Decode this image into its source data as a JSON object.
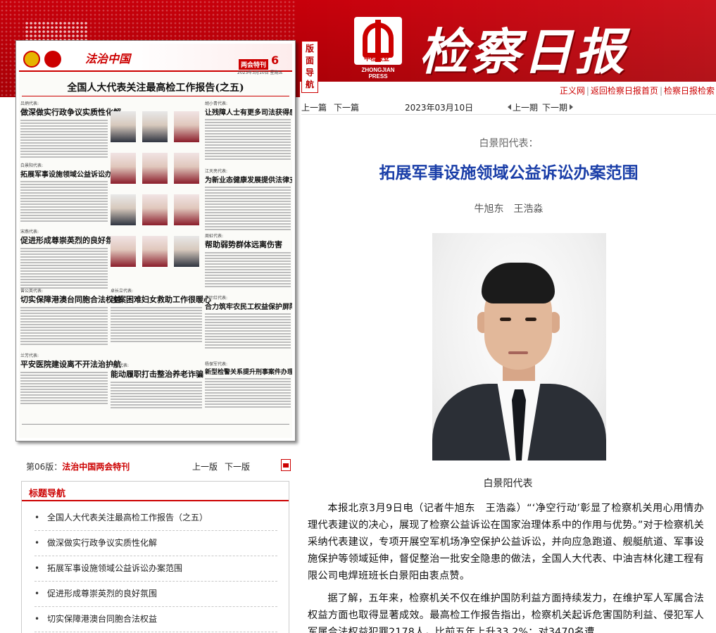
{
  "header": {
    "nav_tag": [
      "版",
      "面",
      "导",
      "航"
    ],
    "logo_label": "中检报业",
    "logo_press": "ZHONGJIAN PRESS",
    "masthead": "检察日报",
    "links": [
      "正义网",
      "返回检察日报首页",
      "检察日报检索"
    ],
    "accent_color": "#c00000"
  },
  "thumbnail": {
    "brand": "法治中国",
    "special_tag": "两会特刊",
    "page_no": "6",
    "date": "2023年3月10日 星期五",
    "big_title": "全国人大代表关注最高检工作报告(之五)",
    "articles": [
      {
        "label": "吕炳代表:",
        "headline": "做深做实行政争议实质性化解"
      },
      {
        "label": "白景阳代表:",
        "headline": "拓展军事设施领域公益诉讼办案范围"
      },
      {
        "label": "宋燕代表:",
        "headline": "促进形成尊崇英烈的良好氛围"
      },
      {
        "label": "曾公英代表:",
        "headline": "切实保障港澳台同胞合法权益"
      },
      {
        "label": "兰芳代表:",
        "headline": "平安医院建设离不开法治护航"
      },
      {
        "label": "胡小青代表:",
        "headline": "让残障人士有更多司法获得感"
      },
      {
        "label": "江天亮代表:",
        "headline": "为新业态健康发展提供法律支持"
      },
      {
        "label": "周虹代表:",
        "headline": "帮助弱势群体远离伤害"
      },
      {
        "label": "李叶红代表:",
        "headline": "合力筑牢农民工权益保护屏障"
      },
      {
        "label": "卓长立代表:",
        "headline": "涉案困难妇女救助工作很暖心"
      },
      {
        "label": "郑锐代表:",
        "headline": "能动履职打击整治养老诈骗"
      },
      {
        "label": "杨保军代表:",
        "headline": "新型检警关系提升刑事案件办理质效"
      }
    ]
  },
  "page_bar": {
    "page_prefix": "第06版：",
    "page_name": "法治中国两会特刊",
    "prev": "上一版",
    "next": "下一版"
  },
  "title_nav": {
    "heading": "标题导航",
    "items": [
      "全国人大代表关注最高检工作报告（之五）",
      "做深做实行政争议实质性化解",
      "拓展军事设施领域公益诉讼办案范围",
      "促进形成尊崇英烈的良好氛围",
      "切实保障港澳台同胞合法权益"
    ]
  },
  "article_nav": {
    "prev_article": "上一篇",
    "next_article": "下一篇",
    "date": "2023年03月10日",
    "prev_issue": "上一期",
    "next_issue": "下一期"
  },
  "article": {
    "subtitle": "白景阳代表：",
    "headline": "拓展军事设施领域公益诉讼办案范围",
    "author": "牛旭东　王浩淼",
    "photo_caption": "白景阳代表",
    "paragraphs": [
      "本报北京3月9日电（记者牛旭东　王浩淼）“‘净空行动’彰显了检察机关用心用情办理代表建议的决心，展现了检察公益诉讼在国家治理体系中的作用与优势。”对于检察机关采纳代表建议，专项开展空军机场净空保护公益诉讼，并向应急跑道、舰艇航道、军事设施保护等领域延伸，督促整治一批安全隐患的做法，全国人大代表、中油吉林化建工程有限公司电焊班班长白景阳由衷点赞。",
      "据了解，五年来，检察机关不仅在维护国防利益方面持续发力，在维护军人军属合法权益方面也取得显著成效。最高检工作报告指出，检察机关起诉危害国防利益、侵犯军人军属合法权益犯罪2178人，比前五年上升33.2%；对3470名遭"
    ]
  }
}
